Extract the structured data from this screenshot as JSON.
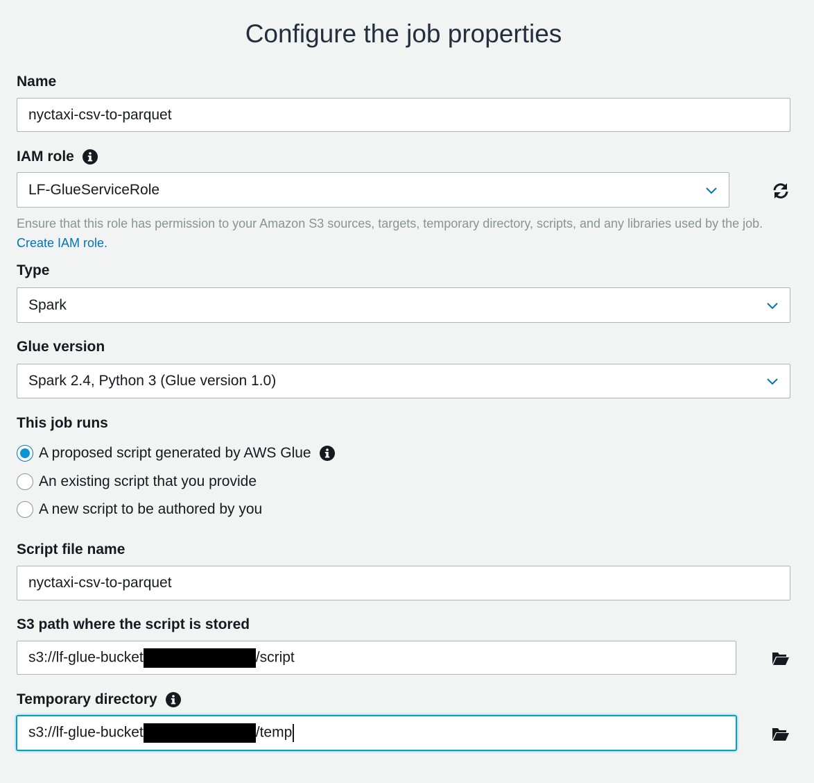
{
  "page": {
    "title": "Configure the job properties"
  },
  "name": {
    "label": "Name",
    "value": "nyctaxi-csv-to-parquet"
  },
  "iam_role": {
    "label": "IAM role",
    "value": "LF-GlueServiceRole",
    "help_text": "Ensure that this role has permission to your Amazon S3 sources, targets, temporary directory, scripts, and any libraries used by the job.",
    "help_link": "Create IAM role."
  },
  "type": {
    "label": "Type",
    "value": "Spark"
  },
  "glue_version": {
    "label": "Glue version",
    "value": "Spark 2.4, Python 3 (Glue version 1.0)"
  },
  "job_runs": {
    "label": "This job runs",
    "options": [
      {
        "label": "A proposed script generated by AWS Glue",
        "checked": true
      },
      {
        "label": "An existing script that you provide",
        "checked": false
      },
      {
        "label": "A new script to be authored by you",
        "checked": false
      }
    ]
  },
  "script_file_name": {
    "label": "Script file name",
    "value": "nyctaxi-csv-to-parquet"
  },
  "s3_path": {
    "label": "S3 path where the script is stored",
    "prefix": "s3://lf-glue-bucket",
    "suffix": "/script"
  },
  "temp_dir": {
    "label": "Temporary directory",
    "prefix": "s3://lf-glue-bucket",
    "suffix": "/temp"
  },
  "icons": {
    "info": "info-icon",
    "chevron": "chevron-down-icon",
    "refresh": "refresh-icon",
    "folder": "folder-open-icon"
  },
  "colors": {
    "accent": "#0073bb",
    "radio_fill": "#0a94d6",
    "focus": "#00a1c9",
    "background": "#f2f3f3"
  }
}
